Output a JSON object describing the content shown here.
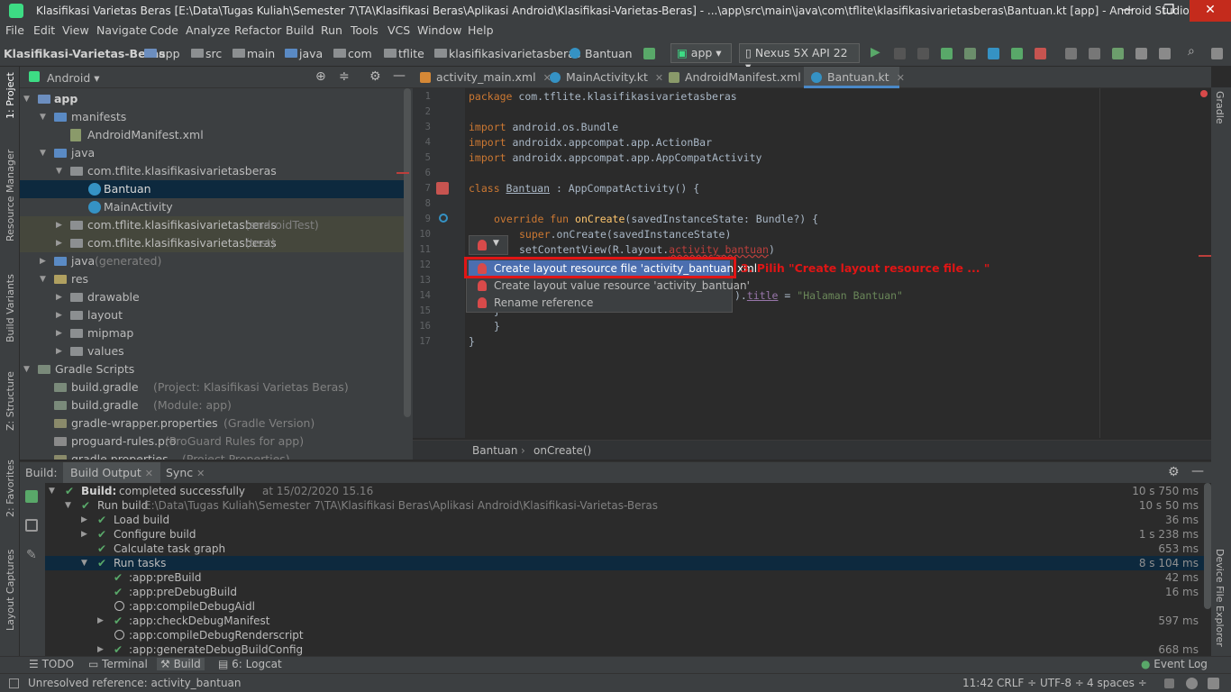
{
  "window": {
    "title": "Klasifikasi Varietas Beras [E:\\Data\\Tugas Kuliah\\Semester 7\\TA\\Klasifikasi Beras\\Aplikasi Android\\Klasifikasi-Varietas-Beras] - ...\\app\\src\\main\\java\\com\\tflite\\klasifikasivarietasberas\\Bantuan.kt [app] - Android Studio",
    "minimize": "—",
    "maximize": "❐",
    "close": "✕"
  },
  "menu": [
    "File",
    "Edit",
    "View",
    "Navigate",
    "Code",
    "Analyze",
    "Refactor",
    "Build",
    "Run",
    "Tools",
    "VCS",
    "Window",
    "Help"
  ],
  "breadcrumb": [
    "Klasifikasi-Varietas-Beras",
    "app",
    "src",
    "main",
    "java",
    "com",
    "tflite",
    "klasifikasivarietasberas",
    "Bantuan"
  ],
  "run_config": "app",
  "device": "Nexus 5X API 22",
  "left_strip": [
    "1: Project",
    "Resource Manager",
    "Build Variants",
    "Z: Structure",
    "2: Favorites",
    "Layout Captures"
  ],
  "right_strip": [
    "Gradle",
    "Device File Explorer"
  ],
  "project_panel": {
    "view": "Android",
    "tree": [
      {
        "label": "app",
        "hint": "",
        "bold": true
      },
      {
        "label": "manifests",
        "hint": ""
      },
      {
        "label": "AndroidManifest.xml",
        "hint": ""
      },
      {
        "label": "java",
        "hint": ""
      },
      {
        "label": "com.tflite.klasifikasivarietasberas",
        "hint": ""
      },
      {
        "label": "Bantuan",
        "hint": ""
      },
      {
        "label": "MainActivity",
        "hint": ""
      },
      {
        "label": "com.tflite.klasifikasivarietasberas",
        "hint": "(androidTest)"
      },
      {
        "label": "com.tflite.klasifikasivarietasberas",
        "hint": "(test)"
      },
      {
        "label": "java",
        "hint": "(generated)"
      },
      {
        "label": "res",
        "hint": ""
      },
      {
        "label": "drawable",
        "hint": ""
      },
      {
        "label": "layout",
        "hint": ""
      },
      {
        "label": "mipmap",
        "hint": ""
      },
      {
        "label": "values",
        "hint": ""
      },
      {
        "label": "Gradle Scripts",
        "hint": ""
      },
      {
        "label": "build.gradle",
        "hint": "(Project: Klasifikasi Varietas Beras)"
      },
      {
        "label": "build.gradle",
        "hint": "(Module: app)"
      },
      {
        "label": "gradle-wrapper.properties",
        "hint": "(Gradle Version)"
      },
      {
        "label": "proguard-rules.pro",
        "hint": "(ProGuard Rules for app)"
      },
      {
        "label": "gradle.properties",
        "hint": "(Project Properties)"
      }
    ]
  },
  "editor_tabs": [
    "activity_main.xml",
    "MainActivity.kt",
    "AndroidManifest.xml",
    "Bantuan.kt"
  ],
  "code": {
    "line_numbers": [
      "1",
      "2",
      "3",
      "4",
      "5",
      "6",
      "7",
      "8",
      "9",
      "10",
      "11",
      "12",
      "13",
      "14",
      "15",
      "16",
      "17"
    ],
    "l1_kw": "package ",
    "l1_rest": "com.tflite.klasifikasivarietasberas",
    "l3_kw": "import ",
    "l3_rest": "android.os.Bundle",
    "l4_kw": "import ",
    "l4_rest": "androidx.appcompat.app.ActionBar",
    "l5_kw": "import ",
    "l5_rest": "androidx.appcompat.app.AppCompatActivity",
    "l7_kw": "class ",
    "l7_name": "Bantuan",
    "l7_rest": " : AppCompatActivity() {",
    "l9_kw": "override fun ",
    "l9_fn": "onCreate",
    "l9_rest": "(savedInstanceState: Bundle?) {",
    "l10_kw": "super",
    "l10_rest": ".onCreate(savedInstanceState)",
    "l11_pre": "setContentView(R.layout.",
    "l11_err": "activity_bantuan",
    "l11_post": ")",
    "l14_pre": ").",
    "l14_prop": "title",
    "l14_mid": " = ",
    "l14_str": "\"Halaman Bantuan\"",
    "l15": "}",
    "l16": "}",
    "l17": "}"
  },
  "popup": {
    "items": [
      "Create layout resource file 'activity_bantuan.xml'",
      "Create layout value resource 'activity_bantuan'",
      "Rename reference"
    ]
  },
  "annotation": "3. Pilih \"Create layout resource file ... \"",
  "editor_breadcrumb": [
    "Bantuan",
    "onCreate()"
  ],
  "build_panel": {
    "label": "Build:",
    "tabs": [
      "Build Output",
      "Sync"
    ],
    "rows": [
      {
        "text": "Build:",
        "extra": " completed successfully",
        "hint": " at 15/02/2020 15.16",
        "time": "10 s 750 ms"
      },
      {
        "text": "Run build",
        "extra": "",
        "hint": " E:\\Data\\Tugas Kuliah\\Semester 7\\TA\\Klasifikasi Beras\\Aplikasi Android\\Klasifikasi-Varietas-Beras",
        "time": "10 s 50 ms"
      },
      {
        "text": "Load build",
        "extra": "",
        "hint": "",
        "time": "36 ms"
      },
      {
        "text": "Configure build",
        "extra": "",
        "hint": "",
        "time": "1 s 238 ms"
      },
      {
        "text": "Calculate task graph",
        "extra": "",
        "hint": "",
        "time": "653 ms"
      },
      {
        "text": "Run tasks",
        "extra": "",
        "hint": "",
        "time": "8 s 104 ms"
      },
      {
        "text": ":app:preBuild",
        "extra": "",
        "hint": "",
        "time": "42 ms"
      },
      {
        "text": ":app:preDebugBuild",
        "extra": "",
        "hint": "",
        "time": "16 ms"
      },
      {
        "text": ":app:compileDebugAidl",
        "extra": "",
        "hint": "",
        "time": ""
      },
      {
        "text": ":app:checkDebugManifest",
        "extra": "",
        "hint": "",
        "time": "597 ms"
      },
      {
        "text": ":app:compileDebugRenderscript",
        "extra": "",
        "hint": "",
        "time": ""
      },
      {
        "text": ":app:generateDebugBuildConfig",
        "extra": "",
        "hint": "",
        "time": "668 ms"
      }
    ]
  },
  "bottom_tools": [
    "TODO",
    "Terminal",
    "Build",
    "6: Logcat"
  ],
  "event_log": "Event Log",
  "status": {
    "message": "Unresolved reference: activity_bantuan",
    "position": "11:42",
    "line_sep": "CRLF ÷",
    "encoding": "UTF-8 ÷",
    "indent": "4 spaces ÷"
  },
  "colors": {
    "accent": "#4b6eaf",
    "error": "#bc3f3c",
    "annotation": "#e01515",
    "success": "#59a869"
  }
}
